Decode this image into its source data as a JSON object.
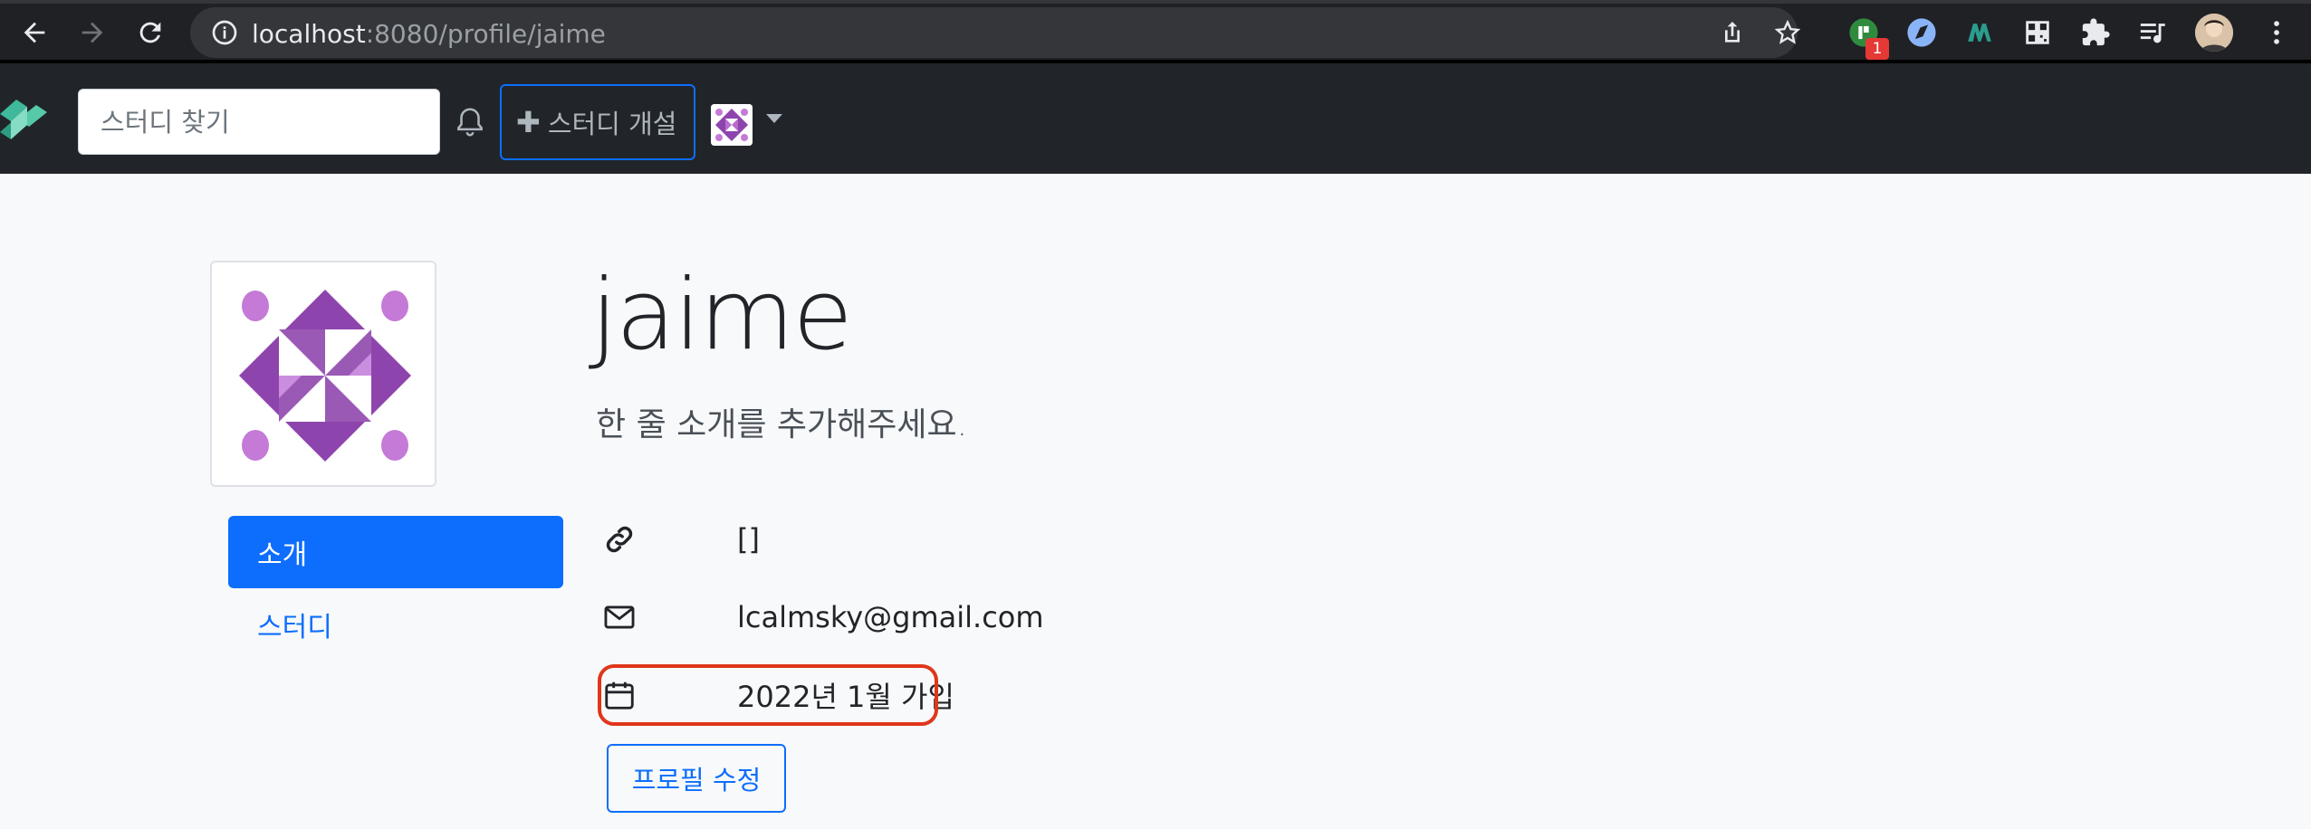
{
  "browser": {
    "url_host": "localhost",
    "url_rest": ":8080/profile/jaime",
    "extension_badge": "1"
  },
  "navbar": {
    "search_placeholder": "스터디 찾기",
    "create_label": "스터디 개설",
    "create_icon": "plus-icon",
    "accent_color": "#0d6efd"
  },
  "profile": {
    "username": "jaime",
    "bio": "한 줄 소개를 추가해주세요.",
    "tabs": [
      {
        "label": "소개",
        "active": true
      },
      {
        "label": "스터디",
        "active": false
      }
    ],
    "info": {
      "url": "[]",
      "email": "lcalmsky@gmail.com",
      "joined": "2022년 1월 가입"
    },
    "edit_label": "프로필 수정"
  }
}
